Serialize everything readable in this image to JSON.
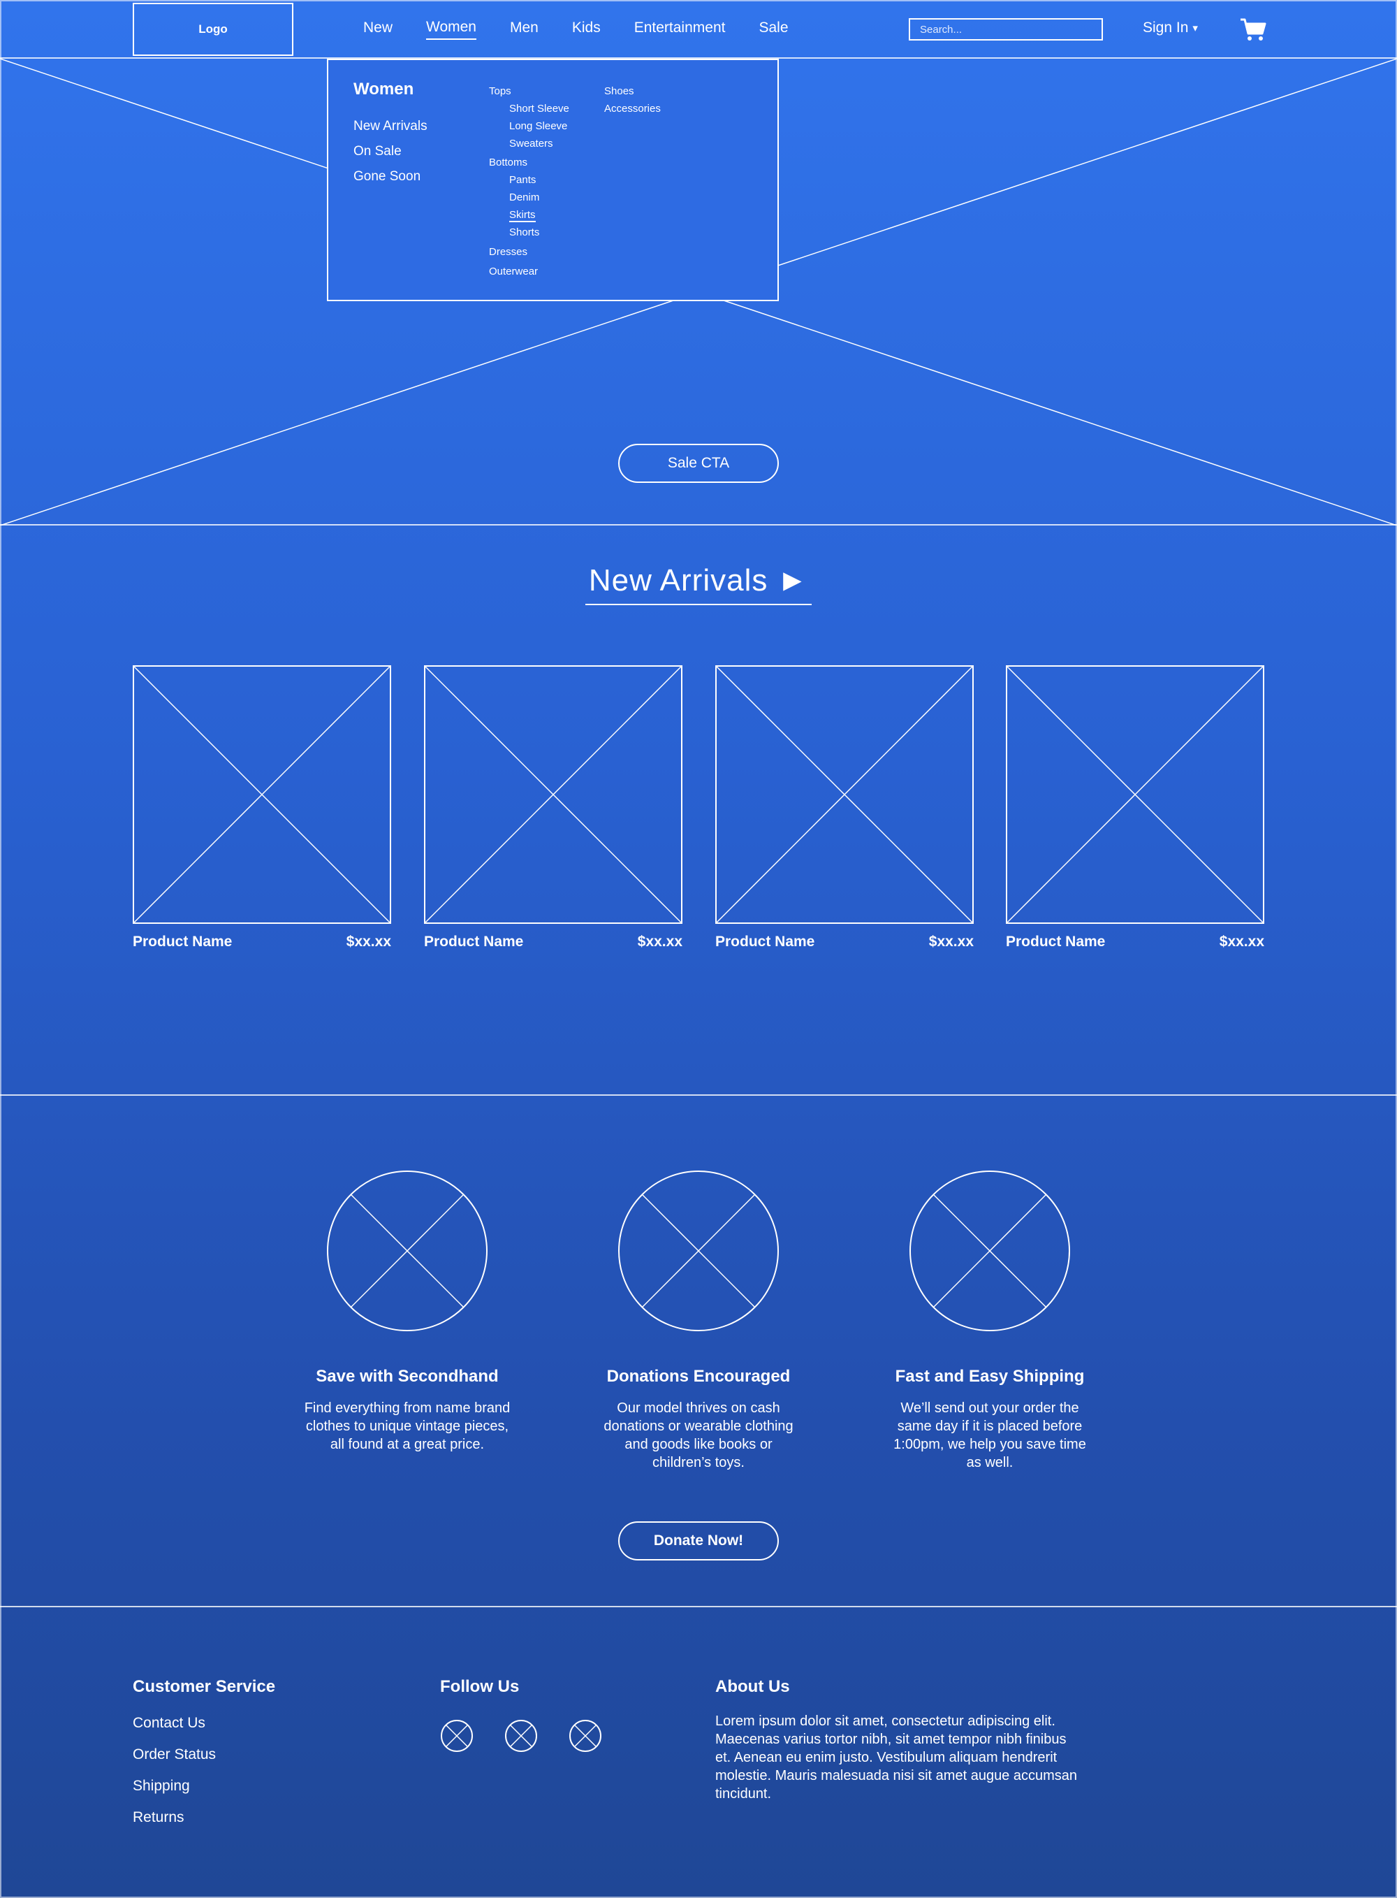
{
  "header": {
    "logo": "Logo",
    "nav": [
      "New",
      "Women",
      "Men",
      "Kids",
      "Entertainment",
      "Sale"
    ],
    "active_nav": "Women",
    "search_placeholder": "Search...",
    "sign_in": "Sign In",
    "sign_in_caret": "▾",
    "cart_icon": "cart-icon"
  },
  "dropdown": {
    "title": "Women",
    "links": [
      "New Arrivals",
      "On Sale",
      "Gone Soon"
    ],
    "col1": {
      "tops": "Tops",
      "tops_items": [
        "Short Sleeve",
        "Long Sleeve",
        "Sweaters"
      ],
      "bottoms": "Bottoms",
      "bottoms_items": [
        "Pants",
        "Denim",
        "Skirts",
        "Shorts"
      ],
      "dresses": "Dresses",
      "outerwear": "Outerwear"
    },
    "col2": {
      "shoes": "Shoes",
      "accessories": "Accessories"
    },
    "hovered_item": "Skirts"
  },
  "hero": {
    "cta": "Sale CTA"
  },
  "arrivals": {
    "title": "New Arrivals ►",
    "products": [
      {
        "name": "Product Name",
        "price": "$xx.xx"
      },
      {
        "name": "Product Name",
        "price": "$xx.xx"
      },
      {
        "name": "Product Name",
        "price": "$xx.xx"
      },
      {
        "name": "Product Name",
        "price": "$xx.xx"
      }
    ]
  },
  "features": {
    "items": [
      {
        "title": "Save with Secondhand",
        "text": "Find everything from name brand clothes to unique vintage pieces, all found at a great price."
      },
      {
        "title": "Donations Encouraged",
        "text": "Our model thrives on cash donations or wearable clothing and goods like books or children’s toys."
      },
      {
        "title": "Fast and Easy Shipping",
        "text": "We’ll send out your order the same day if it is placed before 1:00pm, we help you save time as well."
      }
    ],
    "cta": "Donate Now!"
  },
  "footer": {
    "customer_service": {
      "title": "Customer Service",
      "links": [
        "Contact Us",
        "Order Status",
        "Shipping",
        "Returns"
      ]
    },
    "follow_us": {
      "title": "Follow Us",
      "icons": [
        "social-icon-1",
        "social-icon-2",
        "social-icon-3"
      ]
    },
    "about_us": {
      "title": "About Us",
      "text": "Lorem ipsum dolor sit amet, consectetur adipiscing elit. Maecenas varius tortor nibh, sit amet tempor nibh finibus et. Aenean eu enim justo. Vestibulum aliquam hendrerit molestie. Mauris malesuada nisi sit amet augue accumsan tincidunt."
    }
  },
  "colors": {
    "top": "#3174ec",
    "bottom": "#1f4796",
    "line": "#ffffff"
  }
}
